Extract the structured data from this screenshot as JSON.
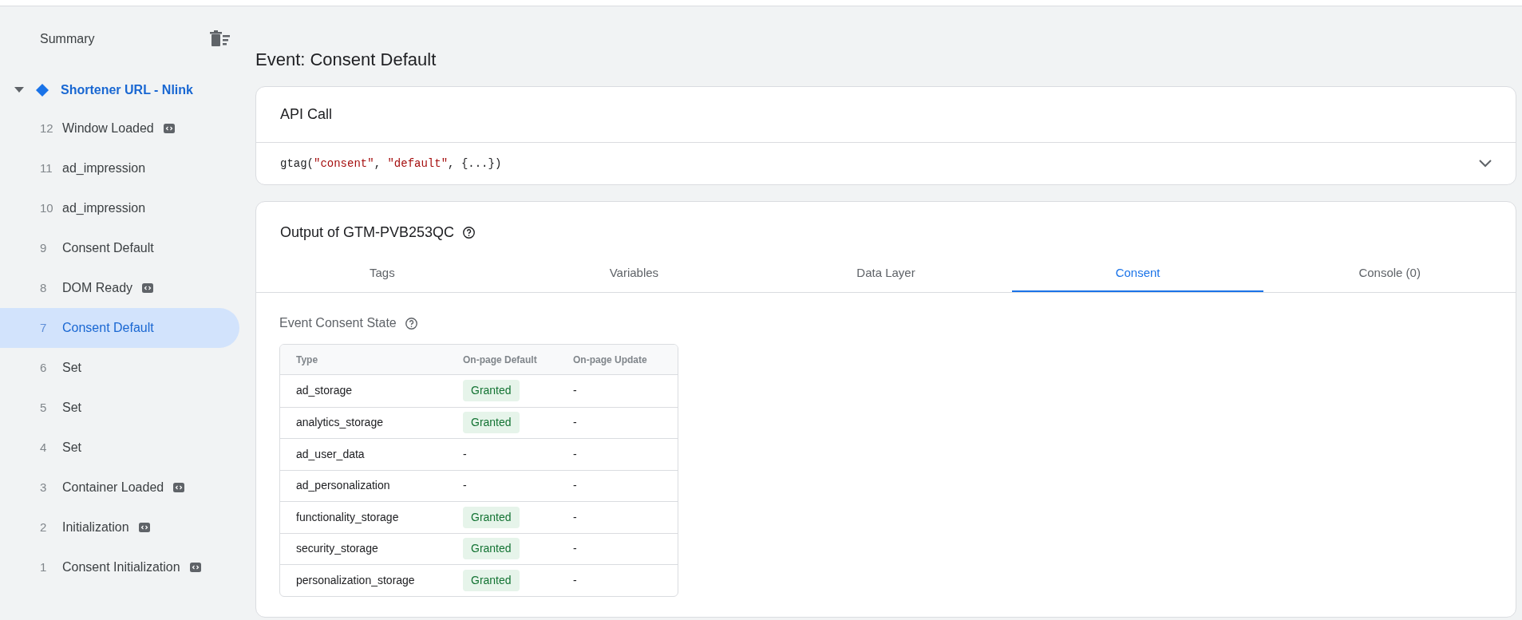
{
  "sidebar": {
    "title": "Summary",
    "container": {
      "name": "Shortener URL - Nlink",
      "expanded": true
    },
    "events": [
      {
        "number": "12",
        "name": "Window Loaded",
        "code_badge": true,
        "selected": false
      },
      {
        "number": "11",
        "name": "ad_impression",
        "code_badge": false,
        "selected": false
      },
      {
        "number": "10",
        "name": "ad_impression",
        "code_badge": false,
        "selected": false
      },
      {
        "number": "9",
        "name": "Consent Default",
        "code_badge": false,
        "selected": false
      },
      {
        "number": "8",
        "name": "DOM Ready",
        "code_badge": true,
        "selected": false
      },
      {
        "number": "7",
        "name": "Consent Default",
        "code_badge": false,
        "selected": true
      },
      {
        "number": "6",
        "name": "Set",
        "code_badge": false,
        "selected": false
      },
      {
        "number": "5",
        "name": "Set",
        "code_badge": false,
        "selected": false
      },
      {
        "number": "4",
        "name": "Set",
        "code_badge": false,
        "selected": false
      },
      {
        "number": "3",
        "name": "Container Loaded",
        "code_badge": true,
        "selected": false
      },
      {
        "number": "2",
        "name": "Initialization",
        "code_badge": true,
        "selected": false
      },
      {
        "number": "1",
        "name": "Consent Initialization",
        "code_badge": true,
        "selected": false
      }
    ]
  },
  "page_title": "Event: Consent Default",
  "api_call": {
    "title": "API Call",
    "code": {
      "fn": "gtag(",
      "arg1": "\"consent\"",
      "sep1": ", ",
      "arg2": "\"default\"",
      "rest": ", {...})"
    },
    "expanded": false
  },
  "output": {
    "title": "Output of GTM-PVB253QC",
    "tabs": [
      {
        "label": "Tags",
        "selected": false
      },
      {
        "label": "Variables",
        "selected": false
      },
      {
        "label": "Data Layer",
        "selected": false
      },
      {
        "label": "Consent",
        "selected": true
      },
      {
        "label": "Console (0)",
        "selected": false
      }
    ],
    "section_title": "Event Consent State",
    "table": {
      "columns": [
        "Type",
        "On-page Default",
        "On-page Update"
      ],
      "rows": [
        {
          "type": "ad_storage",
          "default": {
            "kind": "badge",
            "text": "Granted"
          },
          "update": "-"
        },
        {
          "type": "analytics_storage",
          "default": {
            "kind": "badge",
            "text": "Granted"
          },
          "update": "-"
        },
        {
          "type": "ad_user_data",
          "default": {
            "kind": "text",
            "text": "-"
          },
          "update": "-"
        },
        {
          "type": "ad_personalization",
          "default": {
            "kind": "text",
            "text": "-"
          },
          "update": "-"
        },
        {
          "type": "functionality_storage",
          "default": {
            "kind": "badge",
            "text": "Granted"
          },
          "update": "-"
        },
        {
          "type": "security_storage",
          "default": {
            "kind": "badge",
            "text": "Granted"
          },
          "update": "-"
        },
        {
          "type": "personalization_storage",
          "default": {
            "kind": "badge",
            "text": "Granted"
          },
          "update": "-"
        }
      ]
    }
  }
}
